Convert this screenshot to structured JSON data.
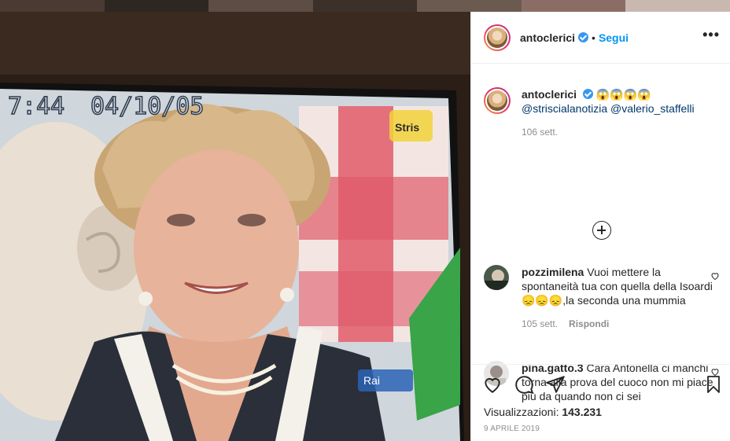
{
  "post": {
    "author": "antoclerici",
    "follow_label": "Segui",
    "more_label": "•••",
    "caption_emojis": "😱😱😱😱",
    "caption_mentions": "@strisciala notizia",
    "mention_1": "@striscialanotizia",
    "mention_2": "@valerio_staffelli",
    "caption_time": "106 sett.",
    "views_label": "Visualizzazioni:",
    "views_count": "143.231",
    "date": "9 APRILE 2019"
  },
  "media": {
    "tv_timestamp_time": "7:44",
    "tv_timestamp_date": "04/10/05",
    "tv_logo": "Stris",
    "channel_logo": "Rai",
    "colors": {
      "background": "#2a1e17",
      "tv_frame": "#101010",
      "checker_red": "#e05a6a",
      "checker_white": "#f3e6e2",
      "green_flag": "#39a448"
    }
  },
  "comments": [
    {
      "username": "pozzimilena",
      "text": "Vuoi mettere la spontaneità tua con quella della Isoardi 😞😞😞,la seconda una mummia",
      "time": "105 sett.",
      "reply_label": "Rispondi"
    },
    {
      "username": "pina.gatto.3",
      "text": "Cara Antonella ci manchi torna alla prova del cuoco non mi piace più da quando non ci sei",
      "time": "",
      "reply_label": ""
    }
  ],
  "icons": [
    "like-icon",
    "comment-icon",
    "share-icon",
    "save-icon",
    "verified-icon",
    "more-icon",
    "load-more-icon",
    "heart-icon"
  ],
  "colors": {
    "link": "#0095f6",
    "mention": "#00376b",
    "meta": "#8e8e8e",
    "verified": "#3897f0"
  }
}
